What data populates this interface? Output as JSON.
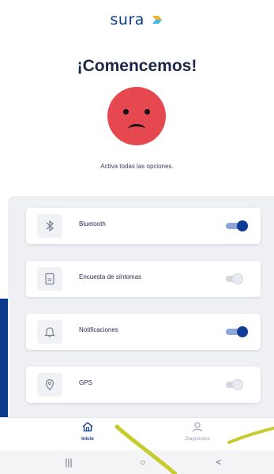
{
  "header": {
    "brand": "sura"
  },
  "main": {
    "title": "¡Comencemos!",
    "mood_icon": "sad-face-icon",
    "subtitle": "Activa todas las opciones."
  },
  "options": [
    {
      "label": "Bluetooth",
      "icon": "bluetooth-icon",
      "enabled": true
    },
    {
      "label": "Encuesta de síntomas",
      "icon": "document-icon",
      "enabled": false
    },
    {
      "label": "Notificaciones",
      "icon": "bell-icon",
      "enabled": true
    },
    {
      "label": "GPS",
      "icon": "location-pin-icon",
      "enabled": false
    }
  ],
  "bottom_nav": {
    "items": [
      {
        "label": "Inicio",
        "icon": "home-icon",
        "active": true
      },
      {
        "label": "Diagnóstico",
        "icon": "diagnosis-icon",
        "active": false
      }
    ]
  },
  "system_nav": {
    "recents": "|||",
    "home": "○",
    "back": "<"
  },
  "colors": {
    "brand": "#0a3a8c",
    "face": "#e6484f",
    "toggle_on": "#0f3c97",
    "accent_stroke": "#c6cc2e"
  }
}
